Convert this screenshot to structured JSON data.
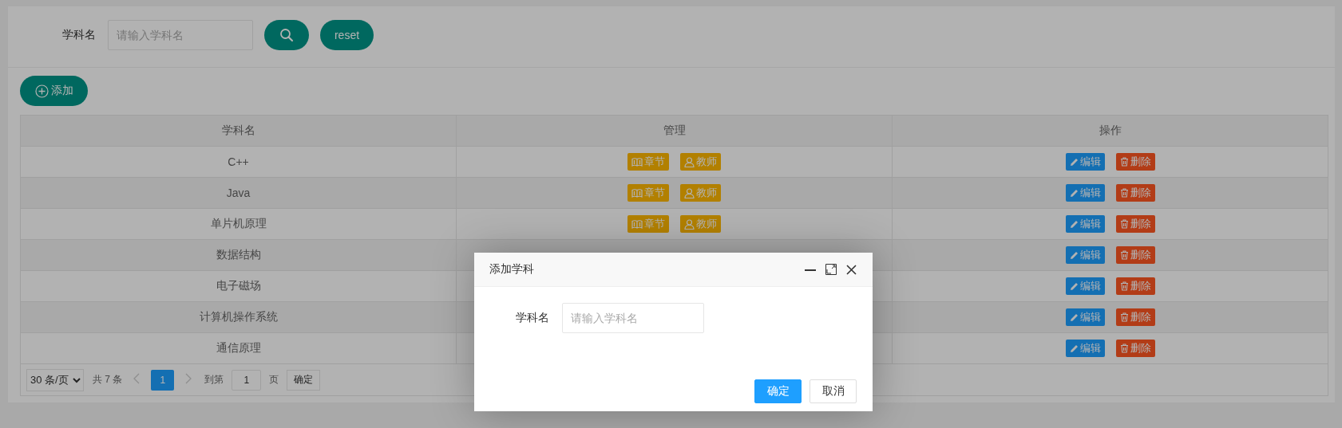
{
  "search": {
    "label": "学科名",
    "placeholder": "请输入学科名",
    "buttons": [
      {
        "kind": "search"
      },
      {
        "kind": "reset",
        "label": "reset"
      }
    ]
  },
  "add_button": {
    "label": "添加"
  },
  "table": {
    "columns": [
      "学科名",
      "管理",
      "操作"
    ],
    "rows": [
      {
        "name": "C++",
        "manage": [
          {
            "kind": "chapter",
            "label": "章节"
          },
          {
            "kind": "teacher",
            "label": "教师"
          }
        ],
        "actions": [
          {
            "kind": "edit",
            "label": "编辑"
          },
          {
            "kind": "delete",
            "label": "删除"
          }
        ]
      },
      {
        "name": "Java",
        "manage": [
          {
            "kind": "chapter",
            "label": "章节"
          },
          {
            "kind": "teacher",
            "label": "教师"
          }
        ],
        "actions": [
          {
            "kind": "edit",
            "label": "编辑"
          },
          {
            "kind": "delete",
            "label": "删除"
          }
        ]
      },
      {
        "name": "单片机原理",
        "manage": [
          {
            "kind": "chapter",
            "label": "章节"
          },
          {
            "kind": "teacher",
            "label": "教师"
          }
        ],
        "actions": [
          {
            "kind": "edit",
            "label": "编辑"
          },
          {
            "kind": "delete",
            "label": "删除"
          }
        ]
      },
      {
        "name": "数据结构",
        "actions": [
          {
            "kind": "edit",
            "label": "编辑"
          },
          {
            "kind": "delete",
            "label": "删除"
          }
        ]
      },
      {
        "name": "电子磁场",
        "actions": [
          {
            "kind": "edit",
            "label": "编辑"
          },
          {
            "kind": "delete",
            "label": "删除"
          }
        ]
      },
      {
        "name": "计算机操作系统",
        "actions": [
          {
            "kind": "edit",
            "label": "编辑"
          },
          {
            "kind": "delete",
            "label": "删除"
          }
        ]
      },
      {
        "name": "通信原理",
        "actions": [
          {
            "kind": "edit",
            "label": "编辑"
          },
          {
            "kind": "delete",
            "label": "删除"
          }
        ]
      }
    ]
  },
  "pagination": {
    "page_size": "30 条/页",
    "total": "共 7 条",
    "pages": [
      {
        "label": "1",
        "selected": true
      }
    ],
    "goto_label": "到第",
    "goto_value": "1",
    "page_unit": "页",
    "confirm": "确定"
  },
  "shade": true,
  "dialog": {
    "title": "添加学科",
    "field_label": "学科名",
    "placeholder": "请输入学科名",
    "buttons": [
      {
        "kind": "primary",
        "label": "确定"
      },
      {
        "kind": "default",
        "label": "取消"
      }
    ]
  }
}
